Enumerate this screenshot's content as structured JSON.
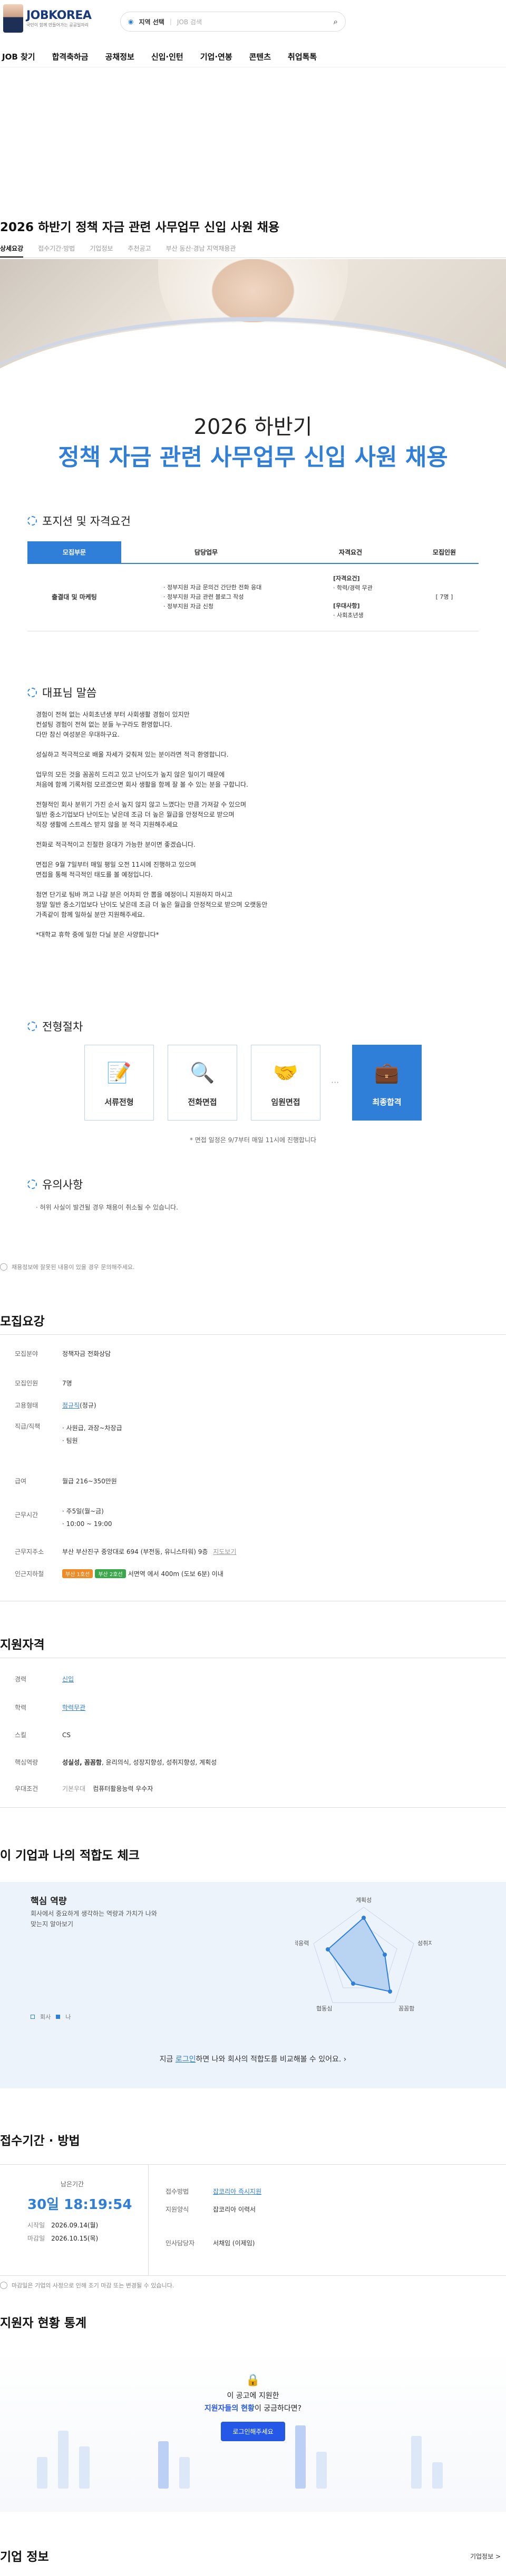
{
  "header": {
    "logo_title": "JOBKOREA",
    "logo_sub": "국민이 함께 만들어가는 공공일자리",
    "region_label": "지역 선택",
    "search_placeholder": "JOB 검색"
  },
  "gnb": [
    "JOB 찾기",
    "합격축하금",
    "공채정보",
    "신입·인턴",
    "기업·연봉",
    "콘텐츠",
    "취업톡톡"
  ],
  "page_title": "2026 하반기 정책 자금 관련 사무업무 신입 사원 채용",
  "tabs": [
    "상세요강",
    "접수기간·방법",
    "기업정보",
    "추천공고",
    "부산 동산·경남 지역채용관"
  ],
  "hero": {
    "year": "2026 하반기",
    "headline": "정책 자금 관련 사무업무 신입 사원 채용"
  },
  "position": {
    "heading": "포지션 및 자격요건",
    "columns": [
      "모집부문",
      "담당업무",
      "자격요건",
      "모집인원"
    ],
    "rows": [
      {
        "dept": "출결대 및 마케팅",
        "duties": [
          "정부지원 자금 문의건 간단한 전화 응대",
          "정부지원 자금 관련 블로그 작성",
          "정부지원 자금 신청"
        ],
        "req_title1": "[자격요건]",
        "req1": "학력/경력 무관",
        "req_title2": "[우대사항]",
        "req2": "사회초년생",
        "count": "[ 7명 ]"
      }
    ]
  },
  "greeting": {
    "heading": "대표님 말씀",
    "paragraphs": [
      "경험이 전혀 없는 사회초년생 부터 사회생활 경험이 있지만\n컨설팅 경험이 전혀 없는 분들 누구라도 환영합니다.\n다만 참신 여성분은 우대하구요.",
      "성실하고 적극적으로 배울 자세가 갖춰져 있는 분이라면 적극 환영합니다.",
      "업무의 모든 것을 꼼꼼히 드리고 있고 난이도가 높지 않은 일이기 때문에\n처음에 함께 기록처럼 모르겠으면 회사 생활을 함께 잘 볼 수 있는 분을 구합니다.",
      "전형적인 회사 분위기 가진 순서 높지 않지 않고 느꼈다는 만큼 가져갈 수 있으며\n일반 중소기업보다 난이도는 낮은데 조금 더 높은 월급을 안정적으로 받으며\n직장 생활에 스트레스 받지 않을 분 적극 지원해주세요",
      "전화로 적극적이고 친절한 응대가 가능한 분이면 좋겠습니다.",
      "면접은 9월 7일부터 매일 평일 오전 11시에 진행하고 있으며\n면접을 통해 적극적인 태도를 볼 예정입니다.",
      "첨연 단기로 팀바 꺼고 나갈 분은 어차피 안 뽑을 예정이니 지원하지 마시고\n정말 일반 중소기업보다 난이도 낮은데 조금 더 높은 월급을 안정적으로 받으며 오랫동안\n가족같이 함께 일하실 분만 지원해주세요.",
      "*대학교 휴학 중에 일한 다닐 분은 사양합니다*"
    ]
  },
  "process": {
    "heading": "전형절차",
    "steps": [
      "서류전형",
      "전화면접",
      "임원면접",
      "최종합격"
    ],
    "dots": "···",
    "note": "* 면접 일정은 9/7부터 매일 11시에 진행합니다"
  },
  "notice": {
    "heading": "유의사항",
    "text": "· 허위 사실이 발견될 경우 채용이 취소될 수 있습니다."
  },
  "warn": "채용정보에 잘못된 내용이 있을 경우 문의해주세요.",
  "recruit": {
    "heading": "모집요강",
    "field_k": "모집분야",
    "field_v": "정책자금 전화상담",
    "count_k": "모집인원",
    "count_v": "7명",
    "type_k": "고용형태",
    "type_v": "정규직",
    "type_extra": "(정규)",
    "level_k": "직급/직책",
    "level_1": "· 사원급, 과장~차장급",
    "level_2": "· 팀원",
    "pay_k": "급여",
    "pay_v": "월급 216~350만원",
    "time_k": "근무시간",
    "time_1": "· 주5일(월~금)",
    "time_2": "· 10:00 ~ 19:00",
    "addr_k": "근무지주소",
    "addr_v": "부산 부산진구 중앙대로 694 (부전동, 유니스타워) 9층",
    "addr_map": "지도보기",
    "subway_k": "인근지하철",
    "subway_b1": "부산 1호선",
    "subway_b2": "부산 2호선",
    "subway_v": "서면역 에서 400m (도보 6분) 이내"
  },
  "qual": {
    "heading": "지원자격",
    "career_k": "경력",
    "career_v": "신입",
    "edu_k": "학력",
    "edu_v": "학력무관",
    "skill_k": "스킬",
    "skill_v": "CS",
    "core_k": "핵심역량",
    "core_v": "성실성, 꼼꼼함",
    "core_rest": ", 윤리의식, 성장지향성, 성취지향성, 계획성",
    "pref_k": "우대조건",
    "pref_label": "기본우대",
    "pref_v": "컴퓨터활용능력 우수자"
  },
  "fit": {
    "heading": "이 기업과 나의 적합도 체크",
    "sub_title": "핵심 역량",
    "desc": "회사에서 중요하게 생각하는 역량과 가치가 나와 맞는지 알아보기",
    "axes": [
      "계획성",
      "성취지향성",
      "꼼꼼함",
      "협동심",
      "적응력"
    ],
    "legend": [
      "회사",
      "나"
    ],
    "footer_pre": "지금 ",
    "footer_link": "로그인",
    "footer_post": "하면 나와 회사의 적합도를 비교해볼 수 있어요.",
    "colors": {
      "company": "#2f7ed8",
      "me": "#b9d3f2"
    }
  },
  "apply": {
    "heading": "접수기간 · 방법",
    "remain_label": "남은기간",
    "remain_time": "30일 18:19:54",
    "start_k": "시작일",
    "start_v": "2026.09.14(월)",
    "end_k": "마감일",
    "end_v": "2026.10.15(목)",
    "method_k": "접수방법",
    "method_v": "잡코리아 즉시지원",
    "form_k": "지원양식",
    "form_v": "잡코리아 이력서",
    "contact_k": "인사담당자",
    "contact_v": "서채임 (이제임)",
    "footnote": "마감일은 기업의 사정으로 인해 조기 마감 또는 변경될 수 있습니다."
  },
  "stats": {
    "heading": "지원자 현황 통계",
    "question_1": "이 공고에 지원한",
    "question_2": "지원자들의 현황",
    "question_3": "이 궁금하다면?",
    "button": "로그인해주세요"
  },
  "company": {
    "heading": "기업 정보",
    "link": "기업정보 >"
  }
}
